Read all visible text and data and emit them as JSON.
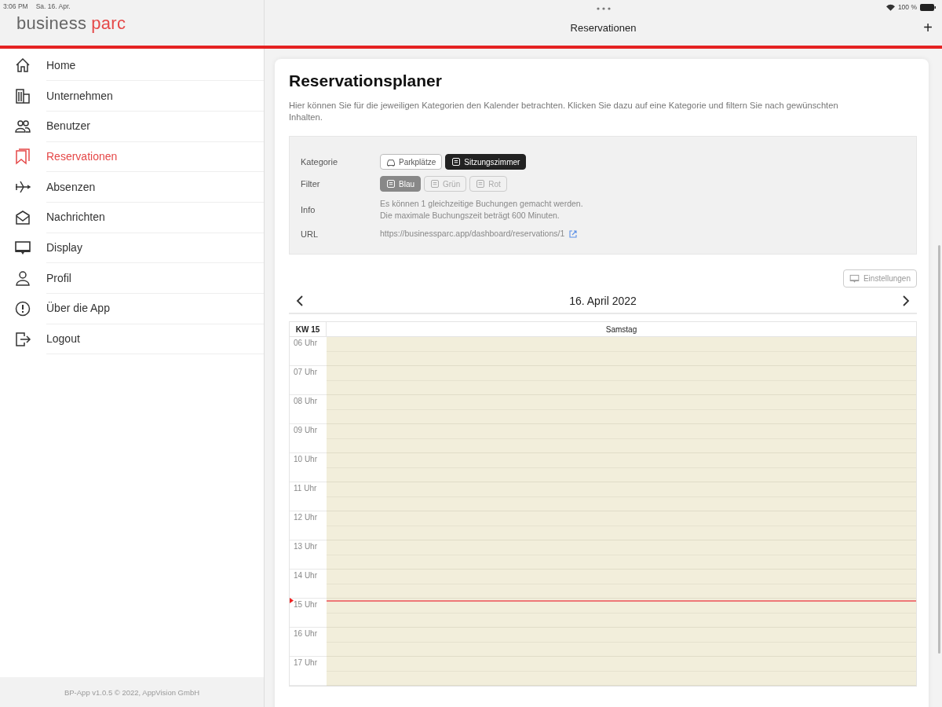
{
  "status_bar": {
    "time": "3:06 PM",
    "date": "Sa. 16. Apr.",
    "battery": "100 %"
  },
  "header": {
    "logo": [
      "business",
      "parc"
    ],
    "title": "Reservationen",
    "add": "+"
  },
  "sidebar": {
    "items": [
      {
        "label": "Home",
        "kind": "home",
        "selected": false
      },
      {
        "label": "Unternehmen",
        "kind": "building",
        "selected": false
      },
      {
        "label": "Benutzer",
        "kind": "users",
        "selected": false
      },
      {
        "label": "Reservationen",
        "kind": "bookmark",
        "selected": true
      },
      {
        "label": "Absenzen",
        "kind": "plane",
        "selected": false
      },
      {
        "label": "Nachrichten",
        "kind": "mail",
        "selected": false
      },
      {
        "label": "Display",
        "kind": "monitor",
        "selected": false
      },
      {
        "label": "Profil",
        "kind": "person",
        "selected": false
      },
      {
        "label": "Über die App",
        "kind": "info",
        "selected": false
      },
      {
        "label": "Logout",
        "kind": "logout",
        "selected": false
      }
    ],
    "footer": "BP-App v1.0.5 © 2022, AppVision GmbH"
  },
  "planner": {
    "title": "Reservationsplaner",
    "description": "Hier können Sie für die jeweiligen Kategorien den Kalender betrachten. Klicken Sie dazu auf eine Kategorie und filtern Sie nach gewünschten Inhalten.",
    "category": {
      "label": "Kategorie",
      "options": [
        {
          "label": "Parkplätze",
          "kind": "car",
          "selected": false
        },
        {
          "label": "Sitzungszimmer",
          "kind": "room",
          "selected": true
        }
      ]
    },
    "filter": {
      "label": "Filter",
      "options": [
        {
          "label": "Blau",
          "selected": true
        },
        {
          "label": "Grün",
          "selected": false
        },
        {
          "label": "Rot",
          "selected": false
        }
      ]
    },
    "info": {
      "label": "Info",
      "lines": [
        "Es können 1 gleichzeitige Buchungen gemacht werden.",
        "Die maximale Buchungszeit beträgt 600 Minuten."
      ]
    },
    "url": {
      "label": "URL",
      "value": "https://businessparc.app/dashboard/reservations/1"
    },
    "settings_button": "Einstellungen",
    "date": "16. April 2022",
    "calendar": {
      "week": "KW 15",
      "day": "Samstag",
      "hours": [
        {
          "label": "06 Uhr",
          "now": false
        },
        {
          "label": "07 Uhr",
          "now": false
        },
        {
          "label": "08 Uhr",
          "now": false
        },
        {
          "label": "09 Uhr",
          "now": false
        },
        {
          "label": "10 Uhr",
          "now": false
        },
        {
          "label": "11 Uhr",
          "now": false
        },
        {
          "label": "12 Uhr",
          "now": false
        },
        {
          "label": "13 Uhr",
          "now": false
        },
        {
          "label": "14 Uhr",
          "now": false
        },
        {
          "label": "15 Uhr",
          "now": true
        },
        {
          "label": "16 Uhr",
          "now": false
        },
        {
          "label": "17 Uhr",
          "now": false
        }
      ]
    }
  }
}
